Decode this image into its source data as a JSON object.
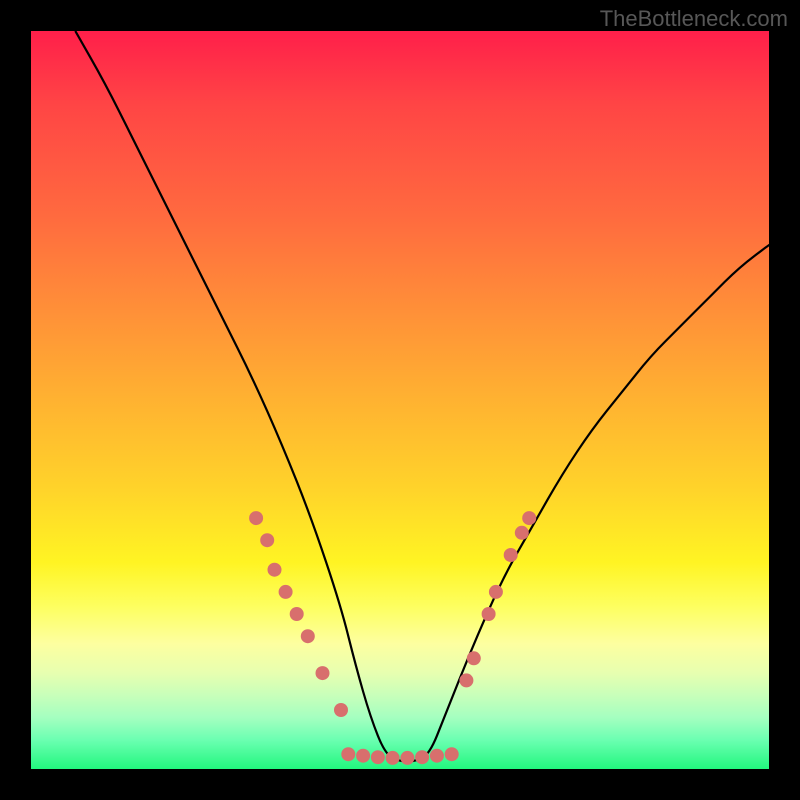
{
  "watermark": "TheBottleneck.com",
  "chart_data": {
    "type": "line",
    "title": "",
    "xlabel": "",
    "ylabel": "",
    "xlim": [
      0,
      100
    ],
    "ylim": [
      0,
      100
    ],
    "grid": false,
    "legend": false,
    "background": {
      "gradient": "vertical",
      "stops": [
        {
          "pos": 0.0,
          "color": "#ff1f4a"
        },
        {
          "pos": 0.5,
          "color": "#ffb231"
        },
        {
          "pos": 0.78,
          "color": "#fdff60"
        },
        {
          "pos": 1.0,
          "color": "#22f77e"
        }
      ]
    },
    "series": [
      {
        "name": "bottleneck-curve",
        "color": "#000000",
        "x": [
          6,
          10,
          14,
          18,
          22,
          26,
          30,
          34,
          38,
          42,
          44,
          46,
          48,
          50,
          52,
          54,
          56,
          60,
          64,
          68,
          72,
          76,
          80,
          84,
          88,
          92,
          96,
          100
        ],
        "y": [
          100,
          93,
          85,
          77,
          69,
          61,
          53,
          44,
          34,
          22,
          14,
          7,
          2,
          1,
          1,
          2,
          7,
          17,
          26,
          33,
          40,
          46,
          51,
          56,
          60,
          64,
          68,
          71
        ]
      }
    ],
    "markers": [
      {
        "name": "left-cluster",
        "color": "#d86f6d",
        "radius": 7,
        "points": [
          {
            "x": 30.5,
            "y": 34
          },
          {
            "x": 32.0,
            "y": 31
          },
          {
            "x": 33.0,
            "y": 27
          },
          {
            "x": 34.5,
            "y": 24
          },
          {
            "x": 36.0,
            "y": 21
          },
          {
            "x": 37.5,
            "y": 18
          },
          {
            "x": 39.5,
            "y": 13
          },
          {
            "x": 42.0,
            "y": 8
          }
        ]
      },
      {
        "name": "bottom-cluster",
        "color": "#d86f6d",
        "radius": 7,
        "points": [
          {
            "x": 43,
            "y": 2.0
          },
          {
            "x": 45,
            "y": 1.8
          },
          {
            "x": 47,
            "y": 1.6
          },
          {
            "x": 49,
            "y": 1.5
          },
          {
            "x": 51,
            "y": 1.5
          },
          {
            "x": 53,
            "y": 1.6
          },
          {
            "x": 55,
            "y": 1.8
          },
          {
            "x": 57,
            "y": 2.0
          }
        ]
      },
      {
        "name": "right-cluster",
        "color": "#d86f6d",
        "radius": 7,
        "points": [
          {
            "x": 59.0,
            "y": 12
          },
          {
            "x": 60.0,
            "y": 15
          },
          {
            "x": 62.0,
            "y": 21
          },
          {
            "x": 63.0,
            "y": 24
          },
          {
            "x": 65.0,
            "y": 29
          },
          {
            "x": 66.5,
            "y": 32
          },
          {
            "x": 67.5,
            "y": 34
          }
        ]
      }
    ]
  }
}
